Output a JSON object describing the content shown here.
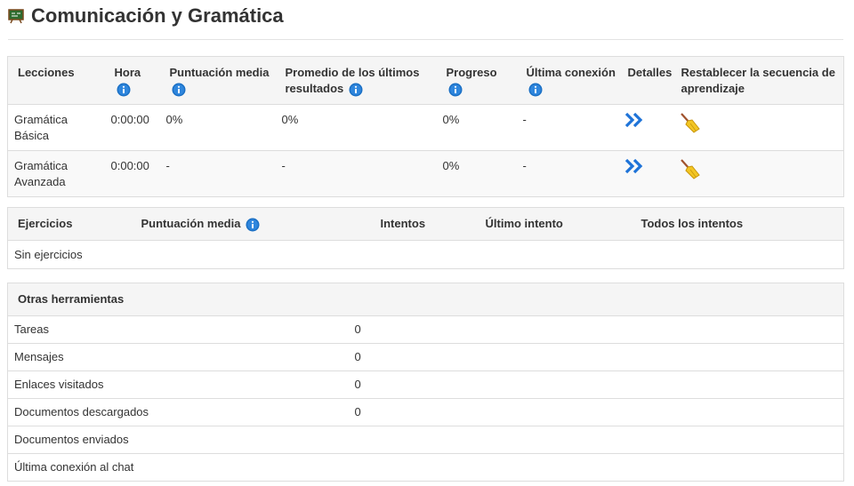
{
  "page": {
    "title": "Comunicación y Gramática",
    "course_icon": "course-board-icon"
  },
  "lessons": {
    "headers": {
      "lessons": "Lecciones",
      "time": "Hora",
      "avg_score": "Puntuación media",
      "avg_last": "Promedio de los últimos resultados",
      "progress": "Progreso",
      "last_connection": "Última conexión",
      "details": "Detalles",
      "reset": "Restablecer la secuencia de aprendizaje"
    },
    "rows": [
      {
        "name": "Gramática Básica",
        "time": "0:00:00",
        "avg_score": "0%",
        "avg_last": "0%",
        "progress": "0%",
        "last_connection": "-",
        "details_icon": "double-chevron-right-icon",
        "reset_icon": "broom-icon"
      },
      {
        "name": "Gramática Avanzada",
        "time": "0:00:00",
        "avg_score": "-",
        "avg_last": "-",
        "progress": "0%",
        "last_connection": "-",
        "details_icon": "double-chevron-right-icon",
        "reset_icon": "broom-icon"
      }
    ]
  },
  "exercises": {
    "headers": {
      "exercises": "Ejercicios",
      "avg_score": "Puntuación media",
      "attempts": "Intentos",
      "last_attempt": "Último intento",
      "all_attempts": "Todos los intentos"
    },
    "empty_text": "Sin ejercicios"
  },
  "tools": {
    "header": "Otras herramientas",
    "rows": [
      {
        "label": "Tareas",
        "value": "0"
      },
      {
        "label": "Mensajes",
        "value": "0"
      },
      {
        "label": "Enlaces visitados",
        "value": "0"
      },
      {
        "label": "Documentos descargados",
        "value": "0"
      },
      {
        "label": "Documentos enviados",
        "value": ""
      },
      {
        "label": "Última conexión al chat",
        "value": ""
      }
    ]
  },
  "colors": {
    "info_icon": "#1a6fc4",
    "details_icon": "#1e73d8",
    "header_bg": "#f5f5f5",
    "border": "#dddddd"
  }
}
